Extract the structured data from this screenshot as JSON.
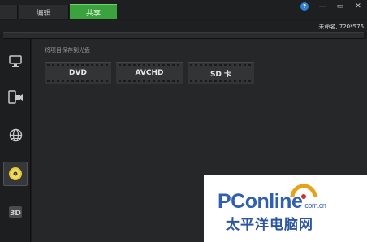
{
  "tabs": [
    {
      "label": ""
    },
    {
      "label": "编辑"
    },
    {
      "label": "共享"
    }
  ],
  "window_controls": {
    "help": "?",
    "minimize": "—",
    "restore": "▭",
    "close": "✕"
  },
  "project_info": "未命名, 720*576",
  "sidebar": {
    "items": [
      {
        "icon": "monitor-icon"
      },
      {
        "icon": "mobile-device-icon"
      },
      {
        "icon": "globe-icon"
      },
      {
        "icon": "disc-icon",
        "active": true
      },
      {
        "icon": "3d-icon",
        "label": "3D"
      }
    ]
  },
  "main": {
    "section_label": "将项目保存到光盘",
    "buttons": [
      {
        "label": "DVD"
      },
      {
        "label": "AVCHD"
      },
      {
        "label": "SD 卡"
      }
    ]
  },
  "watermark": {
    "logo_pc": "PC",
    "logo_online": "online",
    "logo_domain": ".com.cn",
    "chinese": "太平洋电脑网"
  },
  "colors": {
    "accent_green": "#3aa33d",
    "background": "#262728",
    "watermark_blue": "#2f5fb0"
  }
}
